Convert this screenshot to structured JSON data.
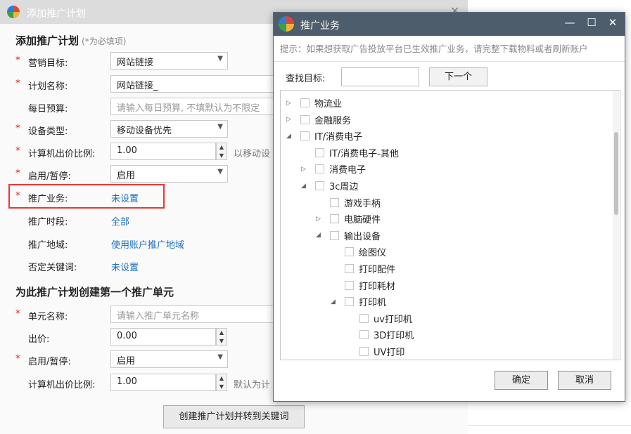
{
  "main_window": {
    "title": "添加推广计划",
    "section1": {
      "title": "添加推广计划",
      "required_hint": "(*为必填项)"
    },
    "fields": {
      "marketing_goal": {
        "label": "营销目标:",
        "value": "网站链接"
      },
      "plan_name": {
        "label": "计划名称:",
        "value": "网站链接_"
      },
      "daily_budget": {
        "label": "每日预算:",
        "placeholder": "请输入每日预算, 不填默认为不限定"
      },
      "device_type": {
        "label": "设备类型:",
        "value": "移动设备优先"
      },
      "pc_bid_ratio": {
        "label": "计算机出价比例:",
        "value": "1.00",
        "aside": "以移动设"
      },
      "status": {
        "label": "启用/暂停:",
        "value": "启用"
      },
      "business": {
        "label": "推广业务:",
        "link": "未设置"
      },
      "schedule": {
        "label": "推广时段:",
        "link": "全部"
      },
      "region": {
        "label": "推广地域:",
        "link": "使用账户推广地域"
      },
      "negative_keywords": {
        "label": "否定关键词:",
        "link": "未设置"
      }
    },
    "section2": {
      "title": "为此推广计划创建第一个推广单元"
    },
    "unit_fields": {
      "unit_name": {
        "label": "单元名称:",
        "placeholder": "请输入推广单元名称"
      },
      "bid": {
        "label": "出价:",
        "value": "0.00"
      },
      "status": {
        "label": "启用/暂停:",
        "value": "启用"
      },
      "pc_bid_ratio": {
        "label": "计算机出价比例:",
        "value": "1.00",
        "aside": "默认为计"
      }
    },
    "submit_label": "创建推广计划并转到关键词"
  },
  "dialog": {
    "title": "推广业务",
    "hint": "提示：如果想获取广告投放平台已生效推广业务，请完整下载物料或者刷新账户",
    "search_label": "查找目标:",
    "search_value": "",
    "next_label": "下一个",
    "tree": [
      {
        "label": "物流业",
        "toggle": "▷",
        "level": 0
      },
      {
        "label": "金融服务",
        "toggle": "▷",
        "level": 0
      },
      {
        "label": "IT/消费电子",
        "toggle": "◢",
        "level": 0
      },
      {
        "label": "IT/消费电子-其他",
        "toggle": "",
        "level": 1
      },
      {
        "label": "消费电子",
        "toggle": "▷",
        "level": 1
      },
      {
        "label": "3c周边",
        "toggle": "◢",
        "level": 1
      },
      {
        "label": "游戏手柄",
        "toggle": "",
        "level": 2
      },
      {
        "label": "电脑硬件",
        "toggle": "▷",
        "level": 2
      },
      {
        "label": "输出设备",
        "toggle": "◢",
        "level": 2
      },
      {
        "label": "绘图仪",
        "toggle": "",
        "level": 3
      },
      {
        "label": "打印配件",
        "toggle": "",
        "level": 3
      },
      {
        "label": "打印耗材",
        "toggle": "",
        "level": 3
      },
      {
        "label": "打印机",
        "toggle": "◢",
        "level": 3
      },
      {
        "label": "uv打印机",
        "toggle": "",
        "level": 4
      },
      {
        "label": "3D打印机",
        "toggle": "",
        "level": 4
      },
      {
        "label": "UV打印",
        "toggle": "",
        "level": 4
      }
    ],
    "ok_label": "确定",
    "cancel_label": "取消"
  },
  "colors": {
    "link": "#1e6fc2",
    "required": "#e02020",
    "highlight_box": "#e53935",
    "dialog_titlebar": "#4e5d6b"
  },
  "icons": {
    "app": "app-logo-icon",
    "close": "close-icon",
    "minimize": "minimize-icon",
    "maximize": "maximize-icon"
  }
}
